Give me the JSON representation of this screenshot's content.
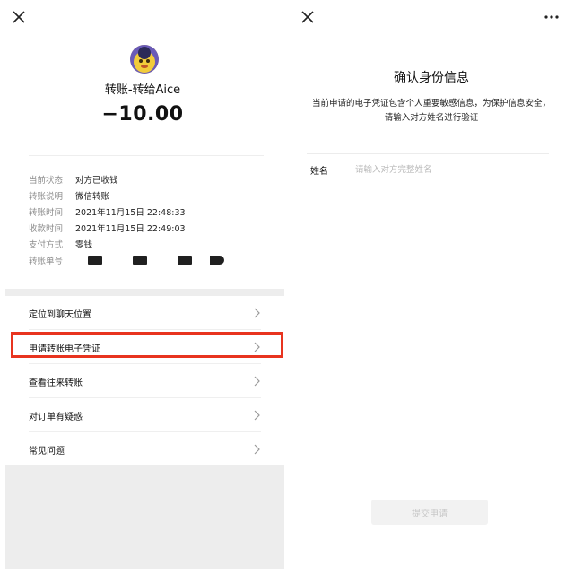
{
  "left": {
    "title": "转账-转给Aice",
    "amount": "−10.00",
    "details": [
      {
        "label": "当前状态",
        "value": "对方已收钱"
      },
      {
        "label": "转账说明",
        "value": "微信转账"
      },
      {
        "label": "转账时间",
        "value": "2021年11月15日 22:48:33"
      },
      {
        "label": "收款时间",
        "value": "2021年11月15日 22:49:03"
      },
      {
        "label": "支付方式",
        "value": "零钱"
      },
      {
        "label": "转账单号",
        "value": ""
      }
    ],
    "menu": [
      {
        "label": "定位到聊天位置"
      },
      {
        "label": "申请转账电子凭证"
      },
      {
        "label": "查看往来转账"
      },
      {
        "label": "对订单有疑惑"
      },
      {
        "label": "常见问题"
      }
    ]
  },
  "right": {
    "title": "确认身份信息",
    "desc_line1": "当前申请的电子凭证包含个人重要敏感信息，为保护信息安全，",
    "desc_line2": "请输入对方姓名进行验证",
    "name_label": "姓名",
    "name_placeholder": "请输入对方完整姓名",
    "name_value": "",
    "submit_label": "提交申请"
  },
  "colors": {
    "highlight": "#e8341f",
    "grey_band": "#ededed",
    "button_bg": "#f2f2f2",
    "button_text": "#c8c8c8"
  },
  "icons": [
    "close-icon",
    "more-icon",
    "chevron-right-icon"
  ]
}
